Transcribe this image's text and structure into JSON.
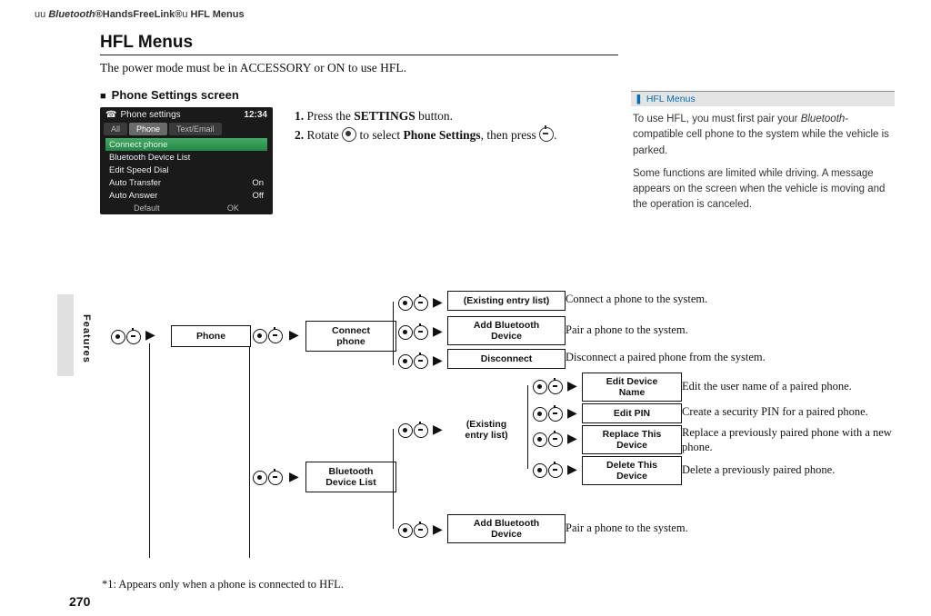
{
  "breadcrumb": {
    "bt": "Bluetooth",
    "hfl": "HandsFreeLink",
    "sec": "HFL Menus"
  },
  "title": "HFL Menus",
  "intro": "The power mode must be in ACCESSORY or ON to use HFL.",
  "sub": "Phone Settings screen",
  "step1a": "1.",
  "step1b": " Press the ",
  "step1c": "SETTINGS",
  "step1d": " button.",
  "step2a": "2.",
  "step2b": " Rotate ",
  "step2c": " to select ",
  "step2d": "Phone Settings",
  "step2e": ", then press ",
  "shot": {
    "title": "Phone settings",
    "clock": "12:34",
    "tabs": [
      "All",
      "Phone",
      "Text/Email"
    ],
    "rows": [
      {
        "l": "Connect phone",
        "r": ""
      },
      {
        "l": "Bluetooth Device List",
        "r": ""
      },
      {
        "l": "Edit Speed Dial",
        "r": ""
      },
      {
        "l": "Auto Transfer",
        "r": "On"
      },
      {
        "l": "Auto Answer",
        "r": "Off"
      }
    ],
    "bot": [
      "Default",
      "OK"
    ]
  },
  "side": {
    "h": "HFL Menus",
    "p1a": "To use HFL, you must first pair your ",
    "p1b": "Bluetooth",
    "p1c": "-compatible cell phone to the system while the vehicle is parked.",
    "p2": "Some functions are limited while driving. A message appears on the screen when the vehicle is moving and the operation is canceled."
  },
  "features": "Features",
  "page": "270",
  "flow": {
    "phone": "Phone",
    "connect": "Connect\nphone",
    "existing": "(Existing entry list)",
    "addbt": "Add Bluetooth\nDevice",
    "disc": "Disconnect",
    "btlist": "Bluetooth\nDevice List",
    "existing2": "(Existing\nentry list)",
    "edname": "Edit Device\nName",
    "edpin": "Edit PIN",
    "repl": "Replace This\nDevice",
    "del": "Delete This\nDevice",
    "addbt2": "Add Bluetooth\nDevice",
    "d_conn": "Connect a phone to the system.",
    "d_pair": "Pair a phone to the system.",
    "d_disc": "Disconnect a paired phone from the system.",
    "d_edname": "Edit the user name of a paired phone.",
    "d_edpin": "Create a security PIN for a paired phone.",
    "d_repl": "Replace a previously paired phone with a new phone.",
    "d_del": "Delete a previously paired phone.",
    "d_pair2": "Pair a phone to the system."
  },
  "footnote": "*1: Appears only when a phone is connected to HFL."
}
